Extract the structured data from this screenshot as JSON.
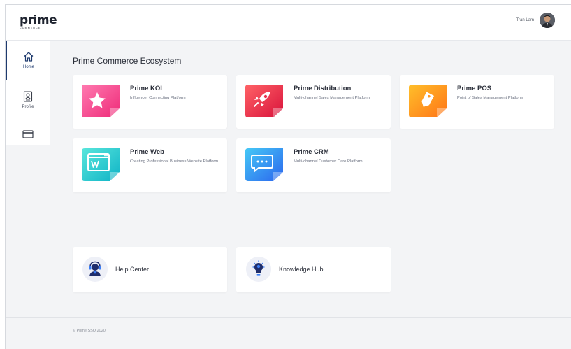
{
  "header": {
    "logo_word": "prime",
    "logo_sub": "COMMERCE",
    "user_name": "Tran Lam"
  },
  "sidebar": {
    "items": [
      {
        "label": "Home",
        "icon": "home-icon",
        "active": true
      },
      {
        "label": "Profile",
        "icon": "profile-badge-icon",
        "active": false
      },
      {
        "label": "",
        "icon": "card-icon",
        "active": false
      }
    ]
  },
  "main": {
    "title": "Prime Commerce Ecosystem",
    "apps": [
      {
        "name": "Prime KOL",
        "desc": "Influencer Connecting Platform",
        "icon": "star-icon",
        "colors": [
          "#ff6fa8",
          "#f2337b"
        ]
      },
      {
        "name": "Prime Distribution",
        "desc": "Multi-channel Sales Management Platform",
        "icon": "rocket-icon",
        "colors": [
          "#ff5a5f",
          "#d9123a"
        ]
      },
      {
        "name": "Prime POS",
        "desc": "Point of Sales Management Platform",
        "icon": "price-tag-icon",
        "colors": [
          "#ffb21e",
          "#ff7a18"
        ]
      },
      {
        "name": "Prime Web",
        "desc": "Creating Professional Business Website Platform",
        "icon": "web-browser-icon",
        "colors": [
          "#4fe3d8",
          "#10b8c8"
        ]
      },
      {
        "name": "Prime CRM",
        "desc": "Multi-channel Customer Care Platform",
        "icon": "chat-bubble-icon",
        "colors": [
          "#3fc5f5",
          "#2e6ef0"
        ]
      }
    ],
    "help": [
      {
        "name": "Help Center",
        "icon": "support-agent-icon"
      },
      {
        "name": "Knowledge Hub",
        "icon": "lightbulb-icon"
      }
    ]
  },
  "footer": {
    "copyright": "© Prime SSO 2020"
  }
}
